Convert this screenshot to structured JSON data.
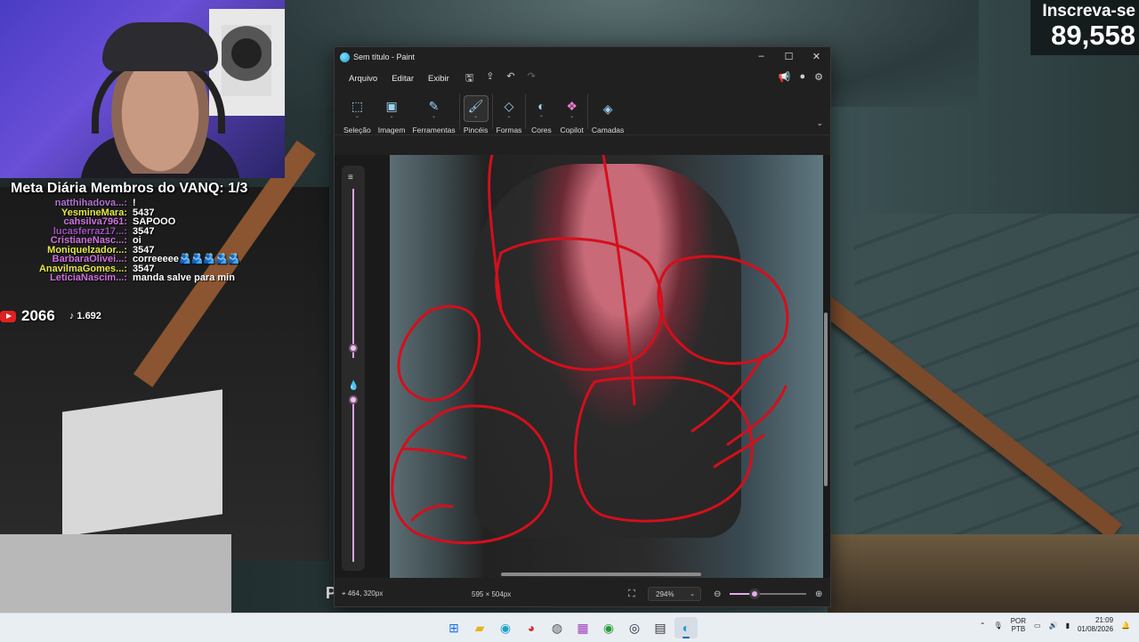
{
  "overlay": {
    "subscribe_label": "Inscreva-se",
    "subscribe_count": "89,558",
    "goal_text": "Meta Diária Membros do VANQ: 1/3",
    "chat": [
      {
        "user": "natthihadova...:",
        "msg": "!",
        "color": "#b070d0"
      },
      {
        "user": "YesmineMara:",
        "msg": "5437",
        "color": "#e4e84a"
      },
      {
        "user": "cahsilva7961:",
        "msg": "SAPOOO",
        "color": "#d070e0"
      },
      {
        "user": "lucasferraz17...:",
        "msg": "3547",
        "color": "#a050c0"
      },
      {
        "user": "CristianeNasc...:",
        "msg": "oi",
        "color": "#d070e0"
      },
      {
        "user": "Moniquelzador...:",
        "msg": "3547",
        "color": "#e4e84a"
      },
      {
        "user": "BarbaraOlivei...:",
        "msg": "correeeee🫂🫂🫂🫂🫂",
        "color": "#d070e0"
      },
      {
        "user": "AnavilmaGomes...:",
        "msg": "3547",
        "color": "#e4e84a"
      },
      {
        "user": "LeticiaNascim...:",
        "msg": "manda salve para min",
        "color": "#d070e0"
      }
    ],
    "youtube_count": "2066",
    "tiktok_count": "1.692",
    "stray_text": "P"
  },
  "paint": {
    "title": "Sem título - Paint",
    "menu": [
      "Arquivo",
      "Editar",
      "Exibir"
    ],
    "ribbon": [
      {
        "label": "Seleção",
        "icon": "selection-icon"
      },
      {
        "label": "Imagem",
        "icon": "image-icon"
      },
      {
        "label": "Ferramentas",
        "icon": "tools-icon"
      },
      {
        "label": "Pincéis",
        "icon": "brush-icon"
      },
      {
        "label": "Formas",
        "icon": "shapes-icon"
      },
      {
        "label": "Cores",
        "icon": "colors-icon"
      },
      {
        "label": "Copilot",
        "icon": "copilot-icon"
      },
      {
        "label": "Camadas",
        "icon": "layers-icon"
      }
    ],
    "status": {
      "cursor_pos": "464, 320px",
      "image_size": "595 × 504px",
      "zoom": "294%",
      "zoom_fraction": 0.33
    },
    "brush_size_fraction": 0.03,
    "opacity_fraction": 0.0
  },
  "taskbar": {
    "apps": [
      "windows-start",
      "file-explorer",
      "edge",
      "chrome",
      "app-5",
      "app-6",
      "app-7",
      "steam",
      "app-9",
      "paint"
    ],
    "lang_top": "POR",
    "lang_bottom": "PTB",
    "time": "21:09",
    "date": "01/08/2026"
  },
  "colors": {
    "paint_bg": "#202020",
    "accent": "#e6a8f0",
    "drawing_red": "#d40f1c"
  }
}
